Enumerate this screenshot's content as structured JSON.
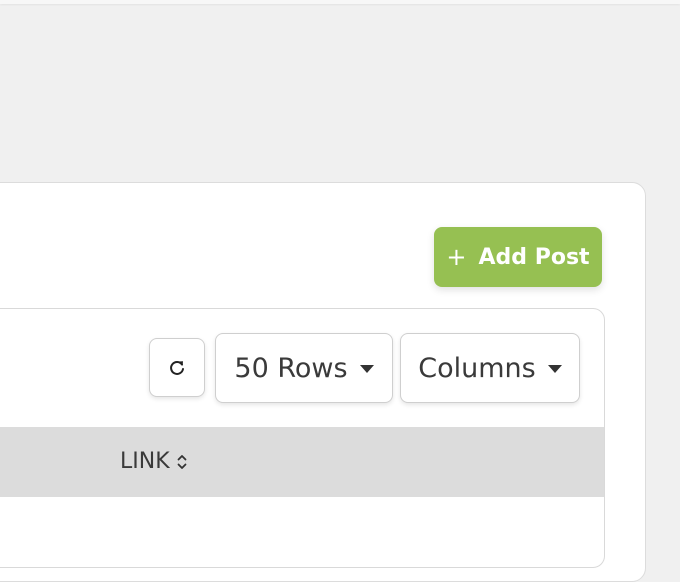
{
  "header": {
    "add_post_icon": "plus-icon",
    "add_post_label": "Add Post"
  },
  "toolbar": {
    "refresh_icon": "refresh-icon",
    "rows_label": "50 Rows",
    "columns_label": "Columns"
  },
  "table": {
    "columns": [
      {
        "label": "LINK",
        "sort_icon": "sort-icon"
      }
    ]
  },
  "colors": {
    "accent": "#96c052",
    "header_bg": "#dcdcdc",
    "page_bg": "#f0f0f0"
  }
}
